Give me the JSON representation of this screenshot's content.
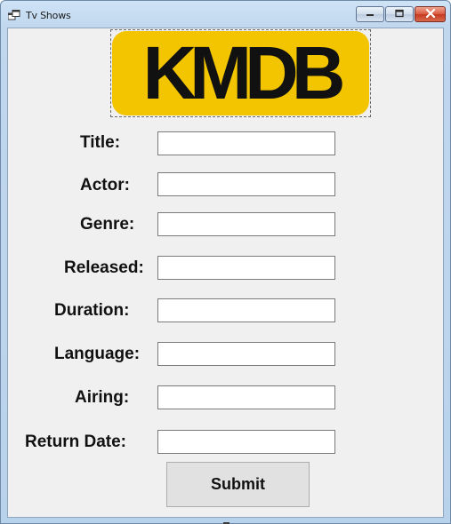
{
  "window": {
    "title": "Tv Shows",
    "icons": {
      "app": "app-window-icon",
      "minimize": "minimize-icon",
      "maximize": "maximize-icon",
      "close": "close-icon"
    },
    "colors": {
      "close_button": "#c43a20",
      "frame": "#b9d2eb",
      "client_background": "#f0f0f0"
    }
  },
  "logo": {
    "text": "KMDB",
    "background": "#f2c500",
    "text_color": "#111111"
  },
  "form": {
    "fields": [
      {
        "label": "Title:",
        "value": ""
      },
      {
        "label": "Actor:",
        "value": ""
      },
      {
        "label": "Genre:",
        "value": ""
      },
      {
        "label": "Released:",
        "value": ""
      },
      {
        "label": "Duration:",
        "value": ""
      },
      {
        "label": "Language:",
        "value": ""
      },
      {
        "label": "Airing:",
        "value": ""
      },
      {
        "label": "Return Date:",
        "value": ""
      }
    ],
    "submit_label": "Submit"
  }
}
